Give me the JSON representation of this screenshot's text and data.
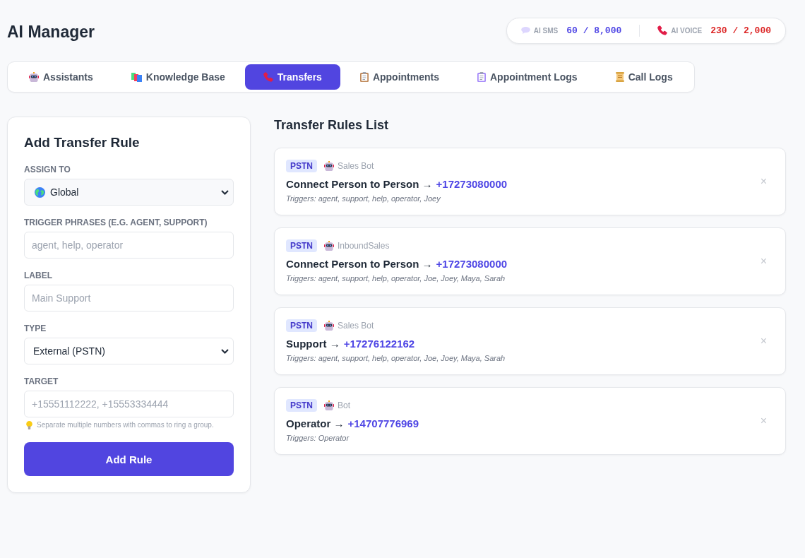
{
  "app_title": "AI Manager",
  "usage": [
    {
      "label": "AI SMS",
      "value": "60 / 8,000",
      "color": "#4f46e5"
    },
    {
      "label": "AI VOICE",
      "value": "230 / 2,000",
      "color": "#dc2626"
    }
  ],
  "tabs": [
    {
      "label": "Assistants",
      "selected": false
    },
    {
      "label": "Knowledge Base",
      "selected": false
    },
    {
      "label": "Transfers",
      "selected": true
    },
    {
      "label": "Appointments",
      "selected": false
    },
    {
      "label": "Appointment Logs",
      "selected": false
    },
    {
      "label": "Call Logs",
      "selected": false
    }
  ],
  "add_rule_form": {
    "title": "Add Transfer Rule",
    "fields": [
      {
        "kind": "select",
        "label": "ASSIGN TO",
        "value": "Global"
      },
      {
        "kind": "text",
        "label": "TRIGGER PHRASES (E.G. AGENT, SUPPORT)",
        "placeholder": "agent, help, operator"
      },
      {
        "kind": "text",
        "label": "LABEL",
        "placeholder": "Main Support"
      },
      {
        "kind": "select",
        "label": "TYPE",
        "value": "External (PSTN)"
      },
      {
        "kind": "text",
        "label": "TARGET",
        "placeholder": "+15551112222, +15553334444",
        "hint": "Separate multiple numbers with commas to ring a group."
      }
    ],
    "submit_button": "Add Rule"
  },
  "transfer_rules": {
    "title": "Transfer Rules List",
    "rules": [
      {
        "type": "PSTN",
        "assistant": "Sales Bot",
        "title": "Connect Person to Person →",
        "target": "+17273080000",
        "triggers": "Triggers: agent, support, help, operator, Joey",
        "remove": "×"
      },
      {
        "type": "PSTN",
        "assistant": "InboundSales",
        "title": "Connect Person to Person →",
        "target": "+17273080000",
        "triggers": "Triggers: agent, support, help, operator, Joe, Joey, Maya, Sarah",
        "remove": "×"
      },
      {
        "type": "PSTN",
        "assistant": "Sales Bot",
        "title": "Support →",
        "target": "+17276122162",
        "triggers": "Triggers: agent, support, help, operator, Joe, Joey, Maya, Sarah",
        "remove": "×"
      },
      {
        "type": "PSTN",
        "assistant": "Bot",
        "title": "Operator →",
        "target": "+14707776969",
        "triggers": "Triggers: Operator",
        "remove": "×"
      }
    ]
  }
}
